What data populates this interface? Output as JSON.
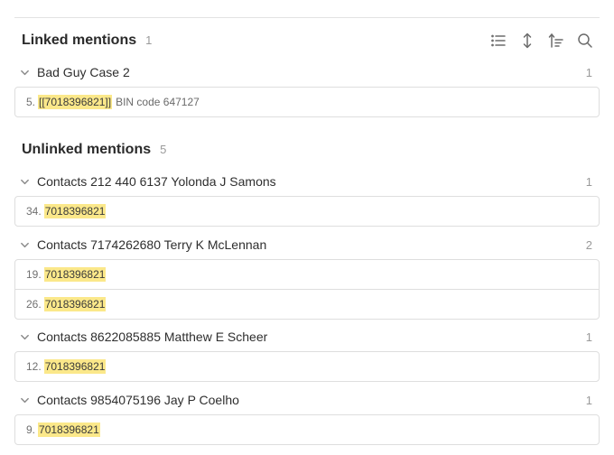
{
  "linked": {
    "title": "Linked mentions",
    "count": "1",
    "groups": [
      {
        "title": "Bad Guy Case 2",
        "count": "1",
        "rows": [
          {
            "num": "5.",
            "match": "[[7018396821]]",
            "suffix": "BIN code 647127"
          }
        ]
      }
    ]
  },
  "toolbar": {
    "icons": [
      "list-icon",
      "expand-vertical-icon",
      "sort-icon",
      "search-icon"
    ]
  },
  "unlinked": {
    "title": "Unlinked mentions",
    "count": "5",
    "groups": [
      {
        "title": "Contacts 212 440 6137 Yolonda J Samons",
        "count": "1",
        "rows": [
          {
            "num": "34.",
            "match": "7018396821"
          }
        ]
      },
      {
        "title": "Contacts 7174262680 Terry K McLennan",
        "count": "2",
        "rows": [
          {
            "num": "19.",
            "match": "7018396821"
          },
          {
            "num": "26.",
            "match": "7018396821"
          }
        ]
      },
      {
        "title": "Contacts 8622085885 Matthew E Scheer",
        "count": "1",
        "rows": [
          {
            "num": "12.",
            "match": "7018396821"
          }
        ]
      },
      {
        "title": "Contacts 9854075196 Jay P Coelho",
        "count": "1",
        "rows": [
          {
            "num": "9.",
            "match": "7018396821"
          }
        ]
      }
    ]
  },
  "colors": {
    "highlight": "#fbe88a",
    "border": "#dedede",
    "muted": "#9a9a9a"
  }
}
